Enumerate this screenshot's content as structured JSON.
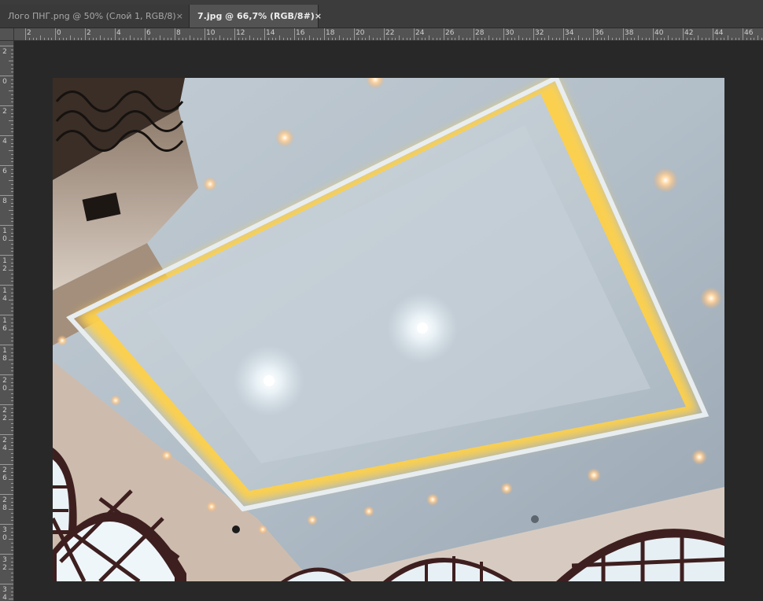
{
  "tabs": [
    {
      "label": "Лого ПНГ.png @ 50% (Слой 1, RGB/8)",
      "close": "×",
      "active": false
    },
    {
      "label": "7.jpg @ 66,7% (RGB/8#)",
      "close": "×",
      "active": true
    }
  ],
  "ruler": {
    "horizontal_labels": [
      "2",
      "0",
      "2",
      "4",
      "6",
      "8",
      "10",
      "12",
      "14",
      "16",
      "18",
      "20",
      "22",
      "24",
      "26",
      "28",
      "30",
      "32",
      "34",
      "36",
      "38",
      "40",
      "42",
      "44",
      "46"
    ],
    "vertical_labels": [
      "2",
      "0",
      "2",
      "4",
      "6",
      "8",
      "10",
      "12",
      "14",
      "16",
      "18",
      "20",
      "22",
      "24",
      "26",
      "28",
      "30",
      "32",
      "34"
    ]
  },
  "document": {
    "name": "7.jpg",
    "zoom": "66,7%",
    "mode": "RGB/8#",
    "content": "ceiling-photo"
  },
  "colors": {
    "tab_active_bg": "#535353",
    "tab_inactive_bg": "#3a3a3a",
    "workspace_bg": "#282828",
    "ruler_bg": "#535353"
  }
}
